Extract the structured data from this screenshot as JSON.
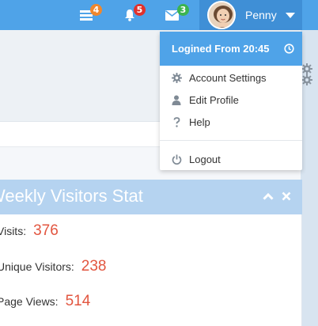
{
  "header": {
    "tasks": {
      "icon": "tasks-icon",
      "count": "4",
      "badge_color": "#f0872d"
    },
    "notifications": {
      "icon": "bell-icon",
      "count": "5",
      "badge_color": "#e0312c"
    },
    "messages": {
      "icon": "envelope-icon",
      "count": "3",
      "badge_color": "#3cb450"
    },
    "user": {
      "name": "Penny",
      "avatar": "user-avatar"
    }
  },
  "user_menu": {
    "header_text": "Logined From 20:45",
    "header_icon": "clock-icon",
    "items": [
      {
        "label": "Account Settings",
        "icon": "gear-icon"
      },
      {
        "label": "Edit Profile",
        "icon": "user-icon"
      },
      {
        "label": "Help",
        "icon": "question-icon"
      },
      {
        "label": "Logout",
        "icon": "power-icon"
      }
    ]
  },
  "widget": {
    "title": "Weekly Visitors Stat",
    "stats": [
      {
        "label": "Visits:",
        "value": "376"
      },
      {
        "label": "Unique Visitors:",
        "value": "238"
      },
      {
        "label": "Page Views:",
        "value": "514"
      }
    ]
  },
  "colors": {
    "primary": "#4fa3e8",
    "widget_header": "#b5d3f0",
    "stat_value": "#e2553f"
  }
}
